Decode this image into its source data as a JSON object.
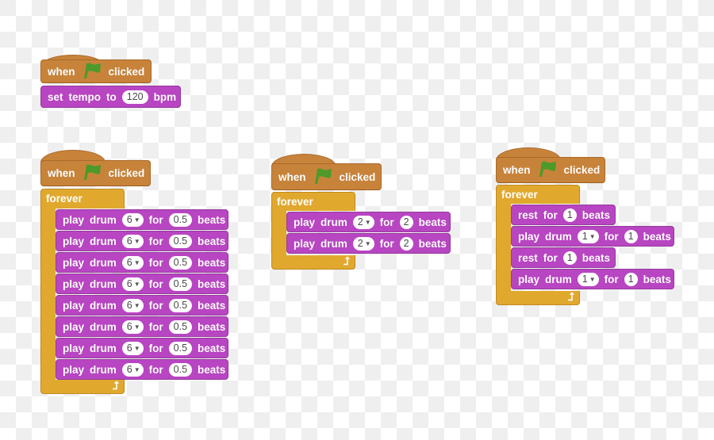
{
  "colors": {
    "events": "#c8833a",
    "control": "#e1a82e",
    "music": "#b845c2",
    "flag": "#4c9a2a",
    "background_light": "#ffffff",
    "background_dark": "#efefef"
  },
  "scripts": [
    {
      "hat": {
        "when": "when",
        "icon": "green-flag-icon",
        "clicked": "clicked"
      },
      "blocks": [
        {
          "parts": [
            "set",
            "tempo",
            "to"
          ],
          "value": "120",
          "suffix": "bpm"
        }
      ]
    },
    {
      "hat": {
        "when": "when",
        "icon": "green-flag-icon",
        "clicked": "clicked"
      },
      "loop_label": "forever",
      "loop_icon": "loop-arrow-icon",
      "blocks": [
        {
          "play": "play",
          "drum": "drum",
          "drum_value": "6",
          "for": "for",
          "beats_value": "0.5",
          "beats": "beats"
        },
        {
          "play": "play",
          "drum": "drum",
          "drum_value": "6",
          "for": "for",
          "beats_value": "0.5",
          "beats": "beats"
        },
        {
          "play": "play",
          "drum": "drum",
          "drum_value": "6",
          "for": "for",
          "beats_value": "0.5",
          "beats": "beats"
        },
        {
          "play": "play",
          "drum": "drum",
          "drum_value": "6",
          "for": "for",
          "beats_value": "0.5",
          "beats": "beats"
        },
        {
          "play": "play",
          "drum": "drum",
          "drum_value": "6",
          "for": "for",
          "beats_value": "0.5",
          "beats": "beats"
        },
        {
          "play": "play",
          "drum": "drum",
          "drum_value": "6",
          "for": "for",
          "beats_value": "0.5",
          "beats": "beats"
        },
        {
          "play": "play",
          "drum": "drum",
          "drum_value": "6",
          "for": "for",
          "beats_value": "0.5",
          "beats": "beats"
        },
        {
          "play": "play",
          "drum": "drum",
          "drum_value": "6",
          "for": "for",
          "beats_value": "0.5",
          "beats": "beats"
        }
      ]
    },
    {
      "hat": {
        "when": "when",
        "icon": "green-flag-icon",
        "clicked": "clicked"
      },
      "loop_label": "forever",
      "loop_icon": "loop-arrow-icon",
      "blocks": [
        {
          "play": "play",
          "drum": "drum",
          "drum_value": "2",
          "for": "for",
          "beats_value": "2",
          "beats": "beats"
        },
        {
          "play": "play",
          "drum": "drum",
          "drum_value": "2",
          "for": "for",
          "beats_value": "2",
          "beats": "beats"
        }
      ]
    },
    {
      "hat": {
        "when": "when",
        "icon": "green-flag-icon",
        "clicked": "clicked"
      },
      "loop_label": "forever",
      "loop_icon": "loop-arrow-icon",
      "blocks": [
        {
          "rest": "rest",
          "for": "for",
          "beats_value": "1",
          "beats": "beats"
        },
        {
          "play": "play",
          "drum": "drum",
          "drum_value": "1",
          "for": "for",
          "beats_value": "1",
          "beats": "beats"
        },
        {
          "rest": "rest",
          "for": "for",
          "beats_value": "1",
          "beats": "beats"
        },
        {
          "play": "play",
          "drum": "drum",
          "drum_value": "1",
          "for": "for",
          "beats_value": "1",
          "beats": "beats"
        }
      ]
    }
  ]
}
